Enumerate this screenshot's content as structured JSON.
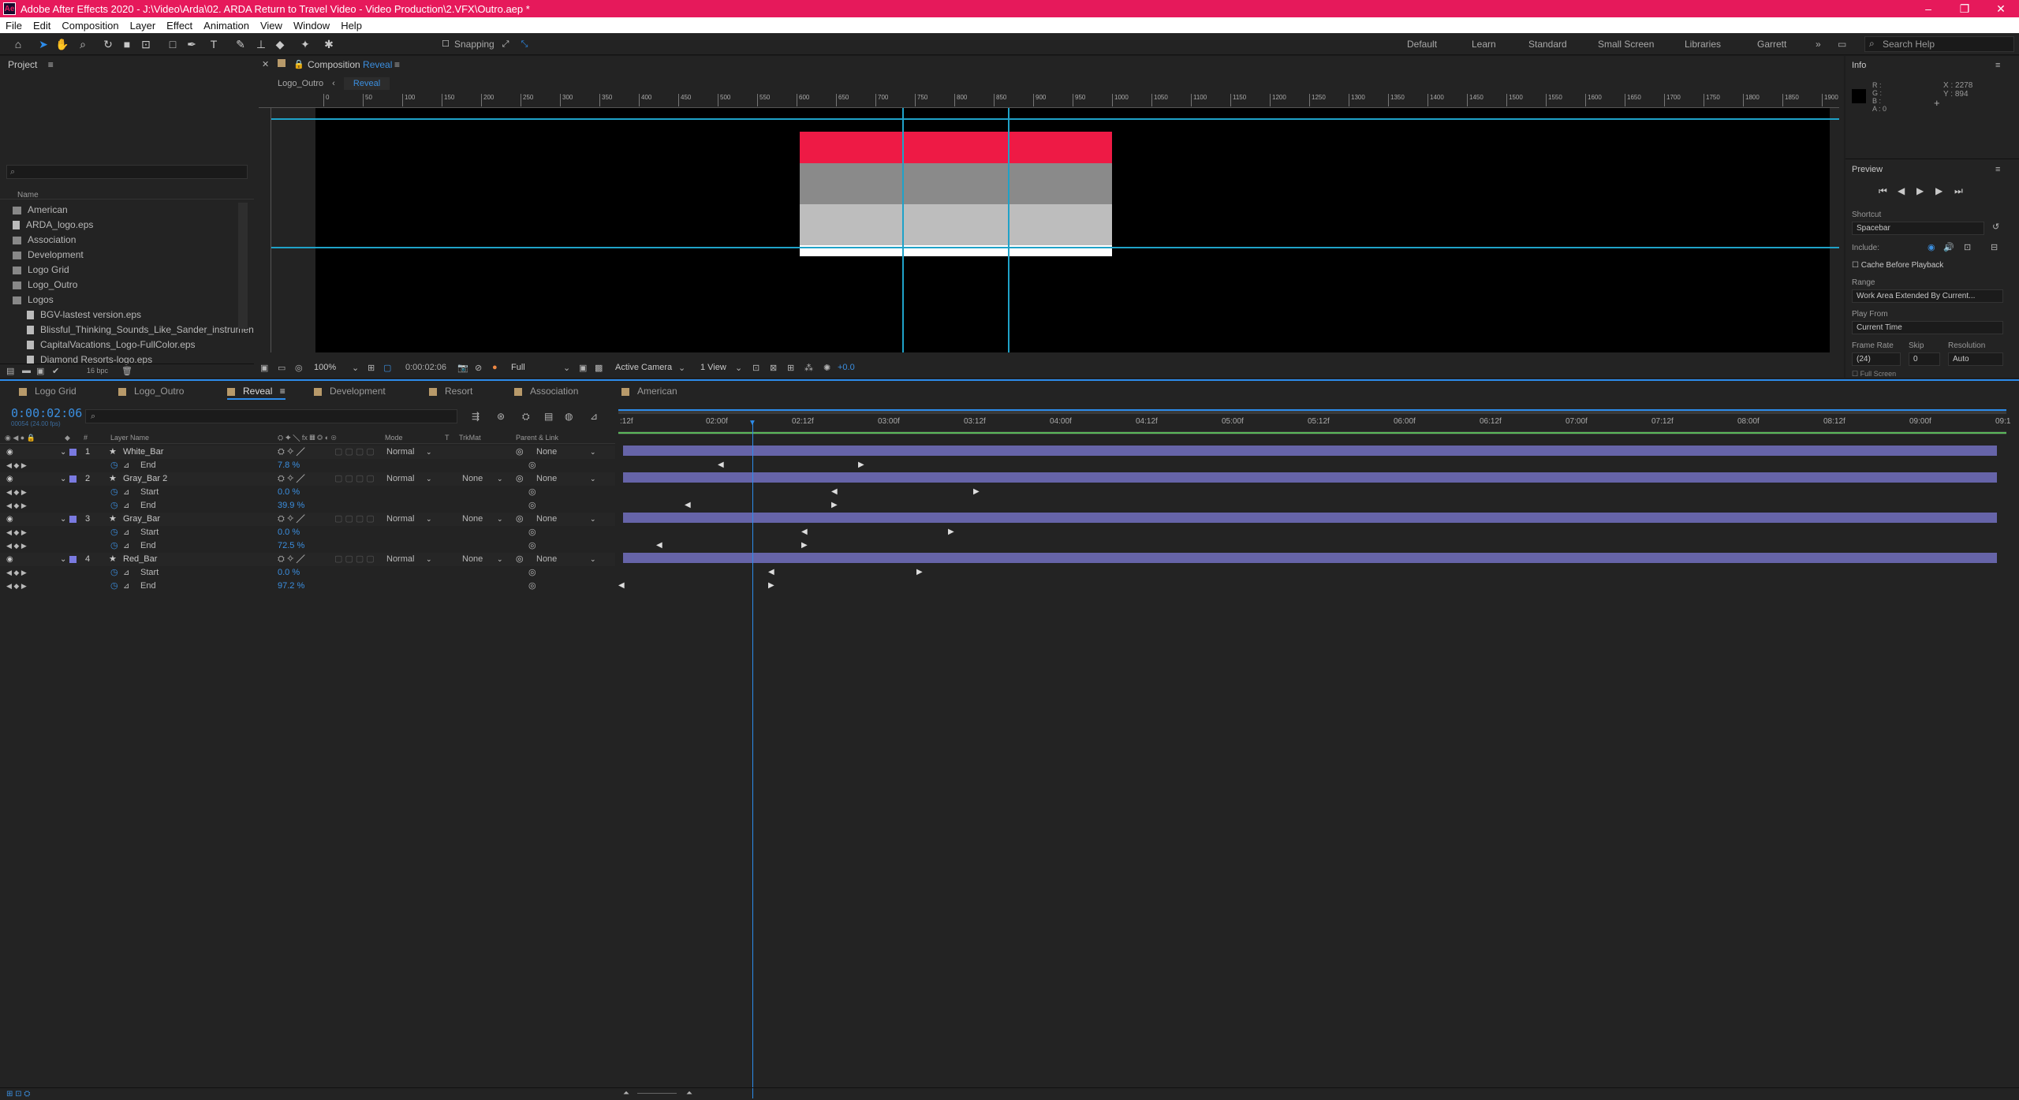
{
  "app": {
    "title": "Adobe After Effects 2020 - J:\\Video\\Arda\\02. ARDA Return to Travel Video - Video Production\\2.VFX\\Outro.aep *",
    "window_controls": [
      "–",
      "❐",
      "✕"
    ]
  },
  "menu": [
    "File",
    "Edit",
    "Composition",
    "Layer",
    "Effect",
    "Animation",
    "View",
    "Window",
    "Help"
  ],
  "toolbar": {
    "snapping_label": "Snapping",
    "workspaces": [
      "Default",
      "Learn",
      "Standard",
      "Small Screen",
      "Libraries",
      "Garrett"
    ],
    "search_placeholder": "Search Help"
  },
  "project": {
    "panel_title": "Project",
    "column_name": "Name",
    "items": [
      {
        "name": "American",
        "type": "folder"
      },
      {
        "name": "ARDA_logo.eps",
        "type": "file"
      },
      {
        "name": "Association",
        "type": "folder"
      },
      {
        "name": "Development",
        "type": "folder"
      },
      {
        "name": "Logo Grid",
        "type": "folder"
      },
      {
        "name": "Logo_Outro",
        "type": "folder"
      },
      {
        "name": "Logos",
        "type": "folder-open"
      },
      {
        "name": "BGV-lastest version.eps",
        "type": "file",
        "indent": 1
      },
      {
        "name": "Blissful_Thinking_Sounds_Like_Sander_instrumen",
        "type": "file",
        "indent": 1
      },
      {
        "name": "CapitalVacations_Logo-FullColor.eps",
        "type": "file",
        "indent": 1
      },
      {
        "name": "Diamond Resorts-logo.eps",
        "type": "file",
        "indent": 1
      }
    ],
    "bpc": "16 bpc"
  },
  "composition": {
    "panel_label": "Composition",
    "comp_name": "Reveal",
    "breadcrumb_parent": "Logo_Outro",
    "breadcrumb_current": "Reveal",
    "ruler_ticks": [
      "0",
      "50",
      "100",
      "150",
      "200",
      "250",
      "300",
      "350",
      "400",
      "450",
      "500",
      "550",
      "600",
      "650",
      "700",
      "750",
      "800",
      "850",
      "900",
      "950",
      "1000",
      "1050",
      "1100",
      "1150",
      "1200",
      "1250",
      "1300",
      "1350",
      "1400",
      "1450",
      "1500",
      "1550",
      "1600",
      "1650",
      "1700",
      "1750",
      "1800",
      "1850",
      "1900"
    ],
    "zoom": "100%",
    "timecode": "0:00:02:06",
    "resolution": "Full",
    "camera": "Active Camera",
    "views": "1 View",
    "exposure": "+0.0",
    "bars_colors": [
      "#ee1a45",
      "#8a8a8a",
      "#bdbdbd",
      "#ffffff"
    ]
  },
  "info": {
    "panel_title": "Info",
    "rgba_labels": [
      "R :",
      "G :",
      "B :",
      "A : 0"
    ],
    "x": "X : 2278",
    "y": "Y : 894"
  },
  "preview": {
    "panel_title": "Preview",
    "shortcut_label": "Shortcut",
    "shortcut_value": "Spacebar",
    "include_label": "Include:",
    "cache_label": "Cache Before Playback",
    "range_label": "Range",
    "range_value": "Work Area Extended By Current...",
    "play_from_label": "Play From",
    "play_from_value": "Current Time",
    "frame_rate_label": "Frame Rate",
    "skip_label": "Skip",
    "resolution_label": "Resolution",
    "frame_rate_value": "(24)",
    "skip_value": "0",
    "resolution_value": "Auto",
    "full_screen_label": "Full Screen"
  },
  "timeline": {
    "tabs": [
      {
        "name": "Logo Grid",
        "color": "#b89a6a"
      },
      {
        "name": "Logo_Outro",
        "color": "#b89a6a"
      },
      {
        "name": "Reveal",
        "color": "#b89a6a",
        "active": true
      },
      {
        "name": "Development",
        "color": "#b89a6a"
      },
      {
        "name": "Resort",
        "color": "#b89a6a"
      },
      {
        "name": "Association",
        "color": "#b89a6a"
      },
      {
        "name": "American",
        "color": "#b89a6a"
      }
    ],
    "current_time": "0:00:02:06",
    "current_frame": "00054 (24.00 fps)",
    "col_headers": {
      "num": "#",
      "layer_name": "Layer Name",
      "mode": "Mode",
      "t": "T",
      "trkmat": "TrkMat",
      "parent": "Parent & Link"
    },
    "ruler_labels": [
      ":12f",
      "02:00f",
      "02:12f",
      "03:00f",
      "03:12f",
      "04:00f",
      "04:12f",
      "05:00f",
      "05:12f",
      "06:00f",
      "06:12f",
      "07:00f",
      "07:12f",
      "08:00f",
      "08:12f",
      "09:00f",
      "09:1"
    ],
    "layers": [
      {
        "num": "1",
        "name": "White_Bar",
        "mode": "Normal",
        "trkmat": "",
        "parent": "None",
        "props": [
          {
            "name": "End",
            "value": "7.8 %"
          }
        ]
      },
      {
        "num": "2",
        "name": "Gray_Bar 2",
        "mode": "Normal",
        "trkmat": "None",
        "parent": "None",
        "props": [
          {
            "name": "Start",
            "value": "0.0 %"
          },
          {
            "name": "End",
            "value": "39.9 %"
          }
        ]
      },
      {
        "num": "3",
        "name": "Gray_Bar",
        "mode": "Normal",
        "trkmat": "None",
        "parent": "None",
        "props": [
          {
            "name": "Start",
            "value": "0.0 %"
          },
          {
            "name": "End",
            "value": "72.5 %"
          }
        ]
      },
      {
        "num": "4",
        "name": "Red_Bar",
        "mode": "Normal",
        "trkmat": "None",
        "parent": "None",
        "props": [
          {
            "name": "Start",
            "value": "0.0 %"
          },
          {
            "name": "End",
            "value": "97.2 %"
          }
        ]
      }
    ]
  }
}
